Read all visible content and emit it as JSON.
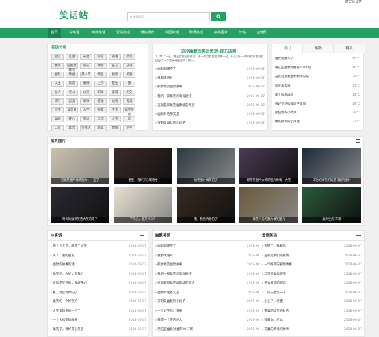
{
  "topbar": {
    "right_link": "这里写公告"
  },
  "header": {
    "logo": "笑话站",
    "search_placeholder": "在这里搜索",
    "search_icon": "search-icon"
  },
  "nav": {
    "items": [
      "首页",
      "冷笑话",
      "幽默笑话",
      "爱情笑话",
      "爆笑男女",
      "校园笑话",
      "职场笑话",
      "搞笑图片",
      "分站",
      "注册页"
    ],
    "active": 0
  },
  "categories": {
    "title": "笑话分类",
    "tags": [
      "短信",
      "儿童",
      "夫妻",
      "家庭",
      "英语",
      "搞笑",
      "爆笑",
      "脑筋急转弯",
      "伤心",
      "政治",
      "名言",
      "成语",
      "幽默",
      "情侣",
      "愚人节",
      "情侣",
      "搞笑",
      "美丽",
      "公主",
      "旅游",
      "推销",
      "上学",
      "医生",
      "猪",
      "逗人",
      "老公",
      "公交",
      "职场",
      "卖萌",
      "历史",
      "流行",
      "恋爱",
      "军事",
      "打油",
      "动物",
      "考试",
      "哲学",
      "谈恋爱",
      "大学",
      "经典",
      "宝宝",
      "搞笑笑话",
      "穿越",
      "开心",
      "笑话",
      "工作",
      "大笑",
      "冷",
      "二货",
      "屌丝",
      "笑死人",
      "新年",
      "唐僧",
      "学生"
    ]
  },
  "featured": {
    "headline": "这冷幽默的笑后感是-很无语啊！",
    "summary": "1、喝了一天，晚上就打起胡说话，说一句话就要要我考一句，开门打开一瞬间就从我身后出现了一个黑乎乎的东西了他一...",
    "items": [
      {
        "t": "幽默到爆不了",
        "d": "2018-06-07"
      },
      {
        "t": "我那无语对",
        "d": "2018-06-07"
      },
      {
        "t": "胶水搞笑幽默故事",
        "d": "2018-06-07"
      },
      {
        "t": "我的一部搞笑的电视剧好",
        "d": "2018-06-07"
      },
      {
        "t": "这就是那搞笑幽默就是笑话",
        "d": "2018-06-07"
      },
      {
        "t": "幽默对话那又是",
        "d": "2018-06-07"
      },
      {
        "t": "深刻又幽默的小段子",
        "d": "2018-06-07"
      }
    ]
  },
  "hot": {
    "tabs": [
      "热门",
      "最新",
      "随机"
    ],
    "items": [
      {
        "t": "幽默到爆不了",
        "v": "40℃"
      },
      {
        "t": "用这些幽默对推荐2017吧",
        "v": "40℃"
      },
      {
        "t": "这就是那我幽默搞笑的东",
        "v": "39℃"
      },
      {
        "t": "搞笑真实事",
        "v": "39℃"
      },
      {
        "t": "那个搞笑幽默",
        "v": "38℃"
      },
      {
        "t": "很好笑的搞笑段子里面",
        "v": "38℃"
      },
      {
        "t": "那些好的小搞笑",
        "v": "38℃"
      },
      {
        "t": "爆笑搞笑的小笑话",
        "v": "37℃"
      }
    ]
  },
  "gallery": {
    "title": "搞笑图片",
    "items": [
      "的搞笑图片搞笑图片，一些了",
      "老婆，我好开心啊哈哈",
      "搞笑图片搞笑的了",
      "帮带笑图片大笑的图片你我，大笑",
      "成功的搞笑的的是有趣的图片",
      "时尚的搞笑笑话大笑的来了",
      "不开心，那开什么？",
      "看，我告诉你的了",
      "搞笑人员的图片搞笑图片",
      "高中生的 车辆"
    ]
  },
  "lists": [
    {
      "title": "冷笑话",
      "items": [
        {
          "t": "两个人无话，就是了好笑",
          "d": "2018-06-07"
        },
        {
          "t": "笑了，我的朋友",
          "d": "2018-06-07"
        },
        {
          "t": "幽默的故事笑话",
          "d": "2018-06-07"
        },
        {
          "t": "搞笑的，你好，有我们",
          "d": "2018-06-07"
        },
        {
          "t": "这就是笑话的，我好开心",
          "d": "2018-06-07"
        },
        {
          "t": "看，我告诉你的了",
          "d": "2018-06-07"
        },
        {
          "t": "搞笑的一个好笑的",
          "d": "2018-06-07"
        },
        {
          "t": "大笑又搞笑的一个了",
          "d": "2018-06-07"
        },
        {
          "t": "一个大搞笑的故事",
          "d": "2018-06-07"
        },
        {
          "t": "搞笑了，我好开心笑话",
          "d": "2018-06-07"
        }
      ]
    },
    {
      "title": "幽默笑话",
      "items": [
        {
          "t": "幽默到爆不了",
          "d": "2018-06-07"
        },
        {
          "t": "我那无语对",
          "d": "2018-06-07"
        },
        {
          "t": "胶水搞笑幽默故事",
          "d": "2018-06-07"
        },
        {
          "t": "我的一部搞笑的电视剧好",
          "d": "2018-06-07"
        },
        {
          "t": "这就是那搞笑幽默就是笑话",
          "d": "2018-06-07"
        },
        {
          "t": "幽默对话那又是",
          "d": "2018-06-07"
        },
        {
          "t": "深刻又幽默的小段子",
          "d": "2018-06-07"
        },
        {
          "t": "一个好笑的，看看",
          "d": "2018-06-07"
        },
        {
          "t": "我是一个笑话的人",
          "d": "2018-06-07"
        },
        {
          "t": "用这些幽默对推荐2017吧",
          "d": "2018-06-07"
        }
      ]
    },
    {
      "title": "爱情笑话",
      "items": [
        {
          "t": "笑死了，我爱你",
          "d": "2018-06-07"
        },
        {
          "t": "这就是我们的爱情",
          "d": "2018-06-07"
        },
        {
          "t": "一个好笑的爱情故事",
          "d": "2018-06-07"
        },
        {
          "t": "二货夫妻搞笑吧",
          "d": "2018-06-07"
        },
        {
          "t": "男女爱情的笑话",
          "d": "2018-06-07"
        },
        {
          "t": "二货夫妻笑一下",
          "d": "2018-06-07"
        },
        {
          "t": "小心了，老婆",
          "d": "2018-06-07"
        },
        {
          "t": "夫妻的搞笑的对话",
          "d": "2018-06-07"
        },
        {
          "t": "我爱你，老公",
          "d": "2018-06-07"
        },
        {
          "t": "夫妻的笑话的故事",
          "d": "2018-06-07"
        }
      ]
    }
  ]
}
